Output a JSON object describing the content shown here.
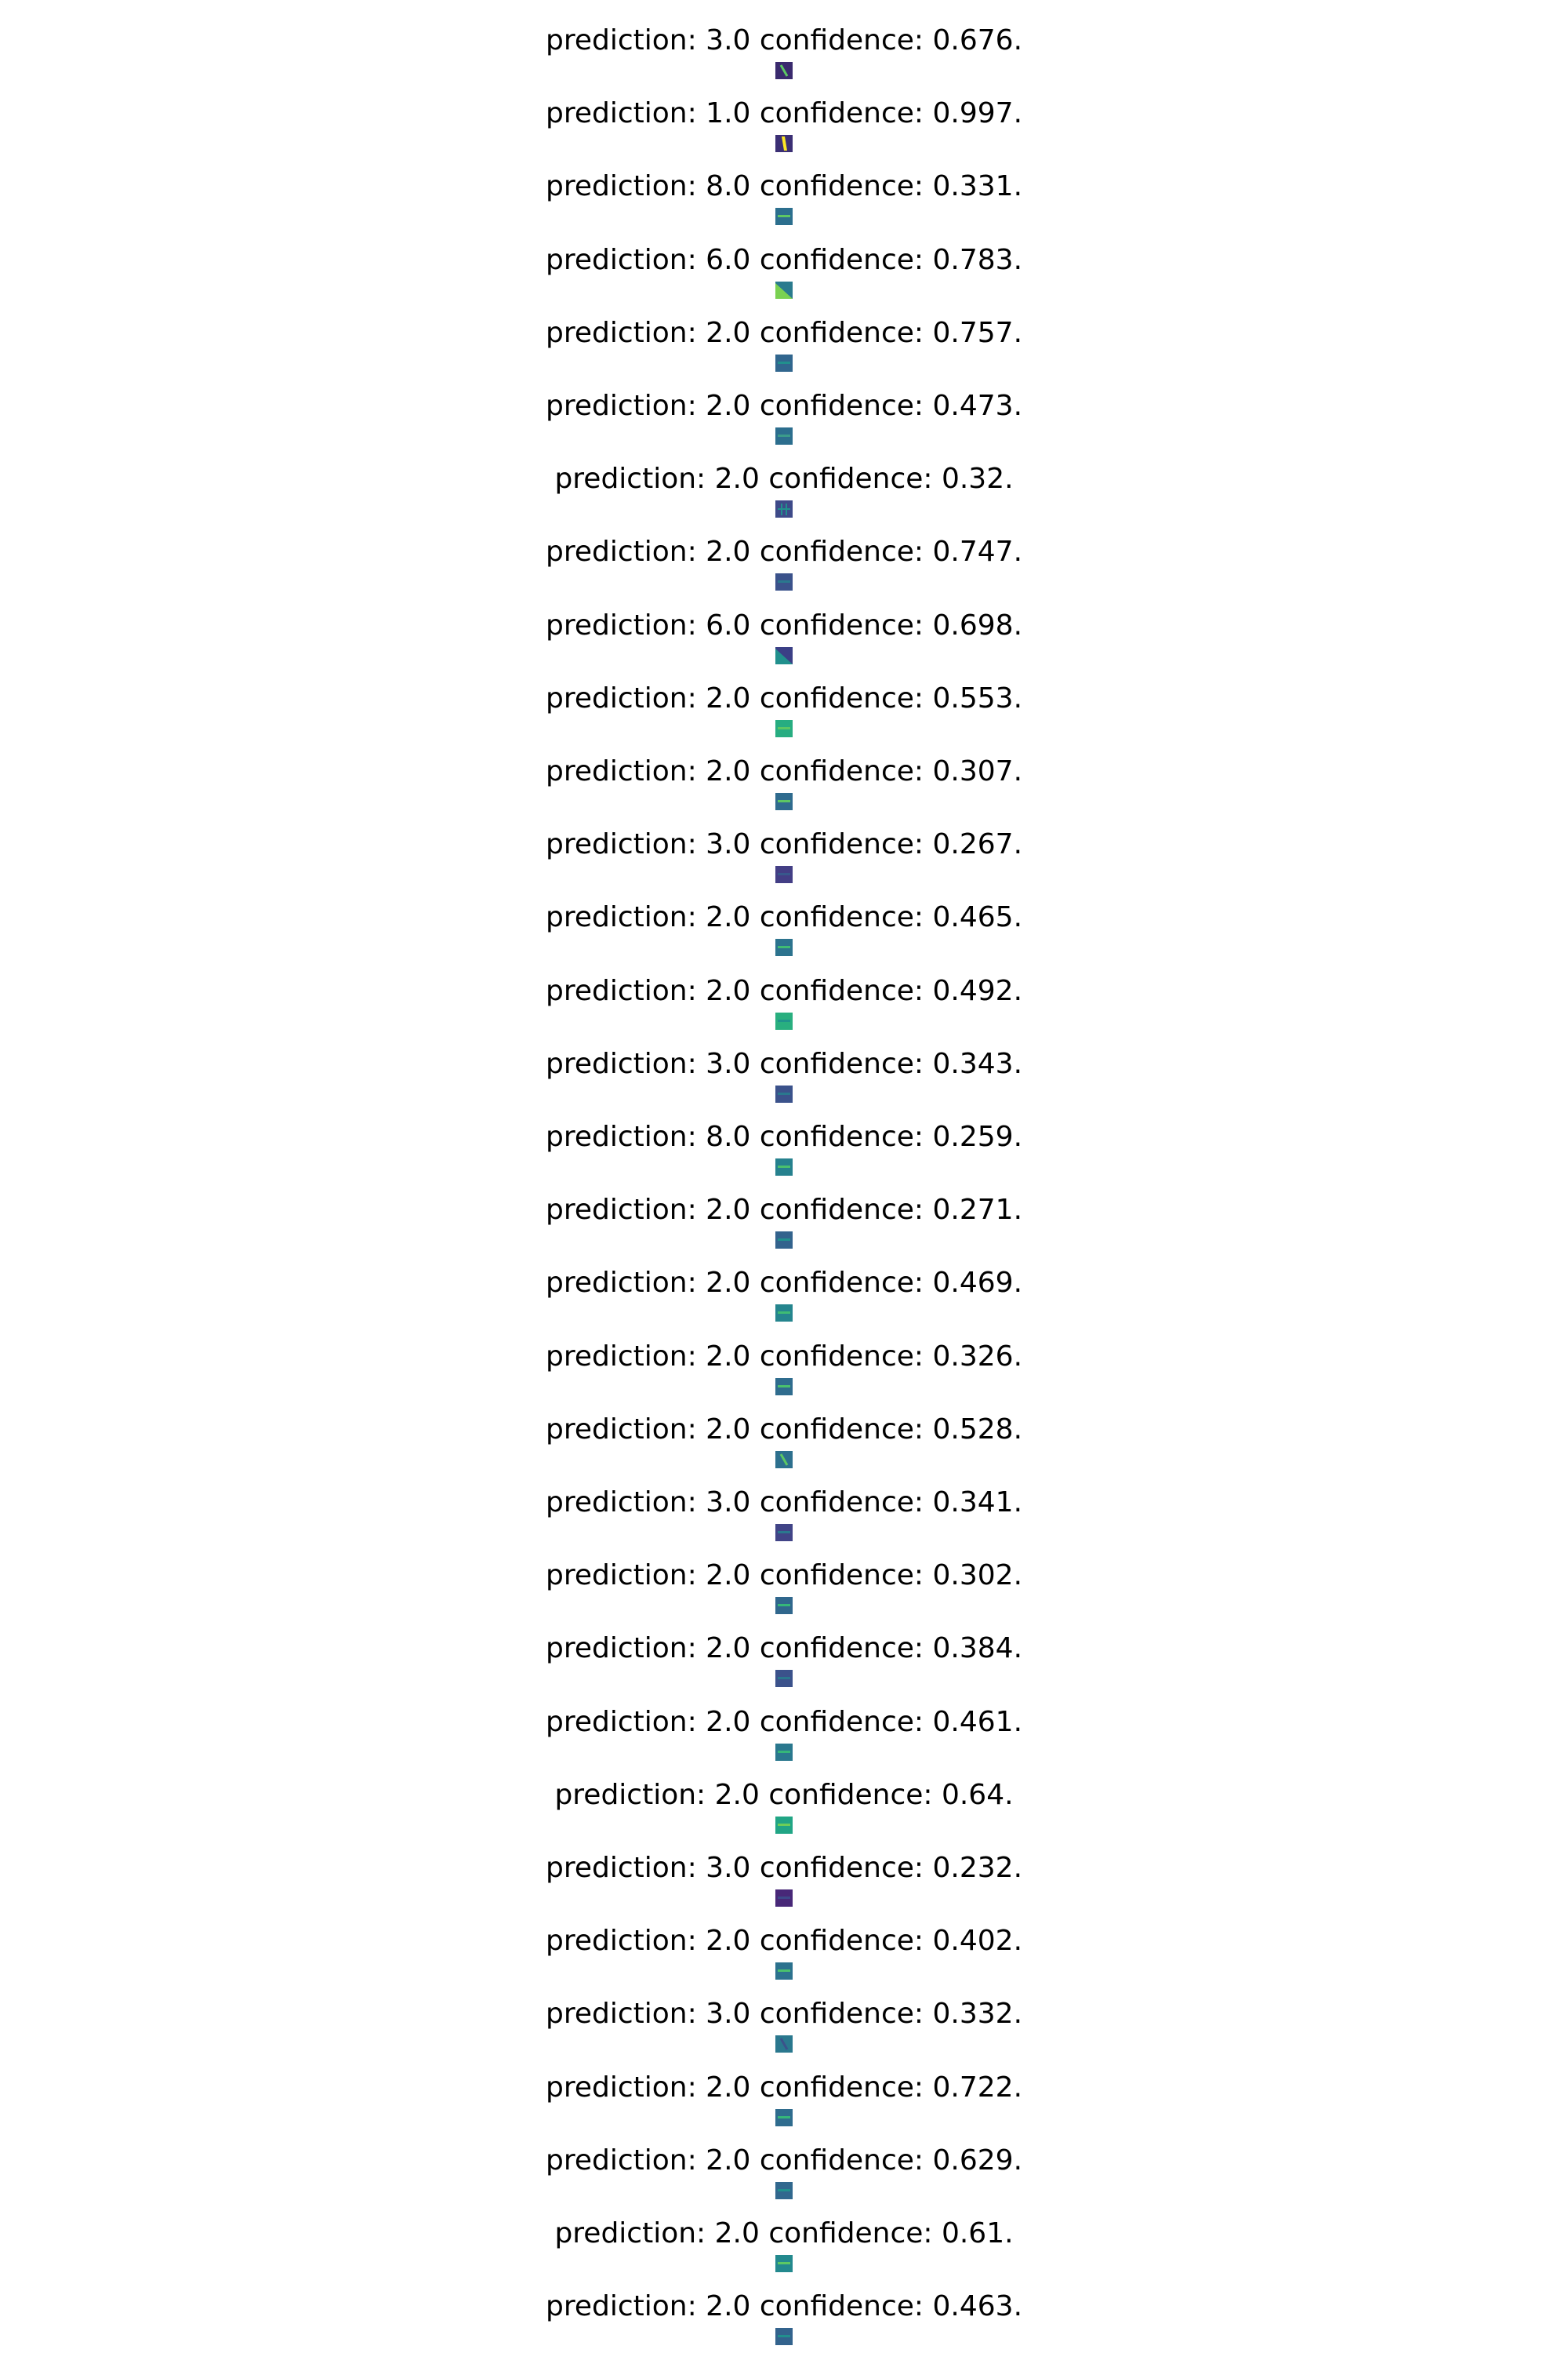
{
  "figure": {
    "colormap": [
      "#440154",
      "#3b528b",
      "#21908d",
      "#5dc863",
      "#fde725"
    ],
    "panels": [
      {
        "title": "prediction: 3.0 confidence: 0.676.",
        "prediction": 3.0,
        "confidence": 0.676,
        "thumb_bg": "#3a2a6e",
        "thumb_fg": "#5dc863",
        "thumb_shape": "diagonal-stroke"
      },
      {
        "title": "prediction: 1.0 confidence: 0.997.",
        "prediction": 1.0,
        "confidence": 0.997,
        "thumb_bg": "#3b2f74",
        "thumb_fg": "#fde725",
        "thumb_shape": "vertical-stroke"
      },
      {
        "title": "prediction: 8.0 confidence: 0.331.",
        "prediction": 8.0,
        "confidence": 0.331,
        "thumb_bg": "#2c6f8e",
        "thumb_fg": "#5dc863",
        "thumb_shape": "horizontal-stroke"
      },
      {
        "title": "prediction: 6.0 confidence: 0.783.",
        "prediction": 6.0,
        "confidence": 0.783,
        "thumb_bg": "#2a7b8e",
        "thumb_fg": "#7ad151",
        "thumb_shape": "triangle"
      },
      {
        "title": "prediction: 2.0 confidence: 0.757.",
        "prediction": 2.0,
        "confidence": 0.757,
        "thumb_bg": "#31668e",
        "thumb_fg": "#21908d",
        "thumb_shape": "horizontal-stroke"
      },
      {
        "title": "prediction: 2.0 confidence: 0.473.",
        "prediction": 2.0,
        "confidence": 0.473,
        "thumb_bg": "#2c6e8e",
        "thumb_fg": "#3b9b8a",
        "thumb_shape": "horizontal-stroke"
      },
      {
        "title": "prediction: 2.0 confidence: 0.32.",
        "prediction": 2.0,
        "confidence": 0.32,
        "thumb_bg": "#3e4a89",
        "thumb_fg": "#21908d",
        "thumb_shape": "cross"
      },
      {
        "title": "prediction: 2.0 confidence: 0.747.",
        "prediction": 2.0,
        "confidence": 0.747,
        "thumb_bg": "#3b528b",
        "thumb_fg": "#2a788e",
        "thumb_shape": "horizontal-stroke"
      },
      {
        "title": "prediction: 6.0 confidence: 0.698.",
        "prediction": 6.0,
        "confidence": 0.698,
        "thumb_bg": "#3b3f86",
        "thumb_fg": "#21908d",
        "thumb_shape": "triangle"
      },
      {
        "title": "prediction: 2.0 confidence: 0.553.",
        "prediction": 2.0,
        "confidence": 0.553,
        "thumb_bg": "#27ad81",
        "thumb_fg": "#5dc863",
        "thumb_shape": "horizontal-stroke"
      },
      {
        "title": "prediction: 2.0 confidence: 0.307.",
        "prediction": 2.0,
        "confidence": 0.307,
        "thumb_bg": "#2f6b8e",
        "thumb_fg": "#5dc863",
        "thumb_shape": "horizontal-stroke"
      },
      {
        "title": "prediction: 3.0 confidence: 0.267.",
        "prediction": 3.0,
        "confidence": 0.267,
        "thumb_bg": "#433e85",
        "thumb_fg": "#38588c",
        "thumb_shape": "horizontal-stroke"
      },
      {
        "title": "prediction: 2.0 confidence: 0.465.",
        "prediction": 2.0,
        "confidence": 0.465,
        "thumb_bg": "#2c738e",
        "thumb_fg": "#3fbc73",
        "thumb_shape": "horizontal-stroke"
      },
      {
        "title": "prediction: 2.0 confidence: 0.492.",
        "prediction": 2.0,
        "confidence": 0.492,
        "thumb_bg": "#29af7f",
        "thumb_fg": "#1f948c",
        "thumb_shape": "horizontal-stroke"
      },
      {
        "title": "prediction: 3.0 confidence: 0.343.",
        "prediction": 3.0,
        "confidence": 0.343,
        "thumb_bg": "#3b528b",
        "thumb_fg": "#2a788e",
        "thumb_shape": "horizontal-stroke"
      },
      {
        "title": "prediction: 8.0 confidence: 0.259.",
        "prediction": 8.0,
        "confidence": 0.259,
        "thumb_bg": "#26818e",
        "thumb_fg": "#4ac16d",
        "thumb_shape": "horizontal-stroke"
      },
      {
        "title": "prediction: 2.0 confidence: 0.271.",
        "prediction": 2.0,
        "confidence": 0.271,
        "thumb_bg": "#33638d",
        "thumb_fg": "#21908d",
        "thumb_shape": "horizontal-stroke"
      },
      {
        "title": "prediction: 2.0 confidence: 0.469.",
        "prediction": 2.0,
        "confidence": 0.469,
        "thumb_bg": "#25858e",
        "thumb_fg": "#3fbc73",
        "thumb_shape": "horizontal-stroke"
      },
      {
        "title": "prediction: 2.0 confidence: 0.326.",
        "prediction": 2.0,
        "confidence": 0.326,
        "thumb_bg": "#2f6c8e",
        "thumb_fg": "#4ac16d",
        "thumb_shape": "horizontal-stroke"
      },
      {
        "title": "prediction: 2.0 confidence: 0.528.",
        "prediction": 2.0,
        "confidence": 0.528,
        "thumb_bg": "#2d708e",
        "thumb_fg": "#5dc863",
        "thumb_shape": "diagonal-stroke"
      },
      {
        "title": "prediction: 3.0 confidence: 0.341.",
        "prediction": 3.0,
        "confidence": 0.341,
        "thumb_bg": "#414487",
        "thumb_fg": "#2a788e",
        "thumb_shape": "horizontal-stroke"
      },
      {
        "title": "prediction: 2.0 confidence: 0.302.",
        "prediction": 2.0,
        "confidence": 0.302,
        "thumb_bg": "#30678d",
        "thumb_fg": "#35b779",
        "thumb_shape": "horizontal-stroke"
      },
      {
        "title": "prediction: 2.0 confidence: 0.384.",
        "prediction": 2.0,
        "confidence": 0.384,
        "thumb_bg": "#3b528b",
        "thumb_fg": "#2a788e",
        "thumb_shape": "horizontal-stroke"
      },
      {
        "title": "prediction: 2.0 confidence: 0.461.",
        "prediction": 2.0,
        "confidence": 0.461,
        "thumb_bg": "#2a788e",
        "thumb_fg": "#35b779",
        "thumb_shape": "horizontal-stroke"
      },
      {
        "title": "prediction: 2.0 confidence: 0.64.",
        "prediction": 2.0,
        "confidence": 0.64,
        "thumb_bg": "#21a585",
        "thumb_fg": "#6ece58",
        "thumb_shape": "horizontal-stroke"
      },
      {
        "title": "prediction: 3.0 confidence: 0.232.",
        "prediction": 3.0,
        "confidence": 0.232,
        "thumb_bg": "#482878",
        "thumb_fg": "#3e4989",
        "thumb_shape": "horizontal-stroke"
      },
      {
        "title": "prediction: 2.0 confidence: 0.402.",
        "prediction": 2.0,
        "confidence": 0.402,
        "thumb_bg": "#2c728e",
        "thumb_fg": "#4ac16d",
        "thumb_shape": "horizontal-stroke"
      },
      {
        "title": "prediction: 3.0 confidence: 0.332.",
        "prediction": 3.0,
        "confidence": 0.332,
        "thumb_bg": "#2a788e",
        "thumb_fg": "#3b528b",
        "thumb_shape": "diagonal-stroke"
      },
      {
        "title": "prediction: 2.0 confidence: 0.722.",
        "prediction": 2.0,
        "confidence": 0.722,
        "thumb_bg": "#2f6c8e",
        "thumb_fg": "#35b779",
        "thumb_shape": "horizontal-stroke"
      },
      {
        "title": "prediction: 2.0 confidence: 0.629.",
        "prediction": 2.0,
        "confidence": 0.629,
        "thumb_bg": "#31688e",
        "thumb_fg": "#21908d",
        "thumb_shape": "horizontal-stroke"
      },
      {
        "title": "prediction: 2.0 confidence: 0.61.",
        "prediction": 2.0,
        "confidence": 0.61,
        "thumb_bg": "#23898e",
        "thumb_fg": "#5dc863",
        "thumb_shape": "horizontal-stroke"
      },
      {
        "title": "prediction: 2.0 confidence: 0.463.",
        "prediction": 2.0,
        "confidence": 0.463,
        "thumb_bg": "#33638d",
        "thumb_fg": "#21908d",
        "thumb_shape": "horizontal-stroke"
      }
    ]
  }
}
